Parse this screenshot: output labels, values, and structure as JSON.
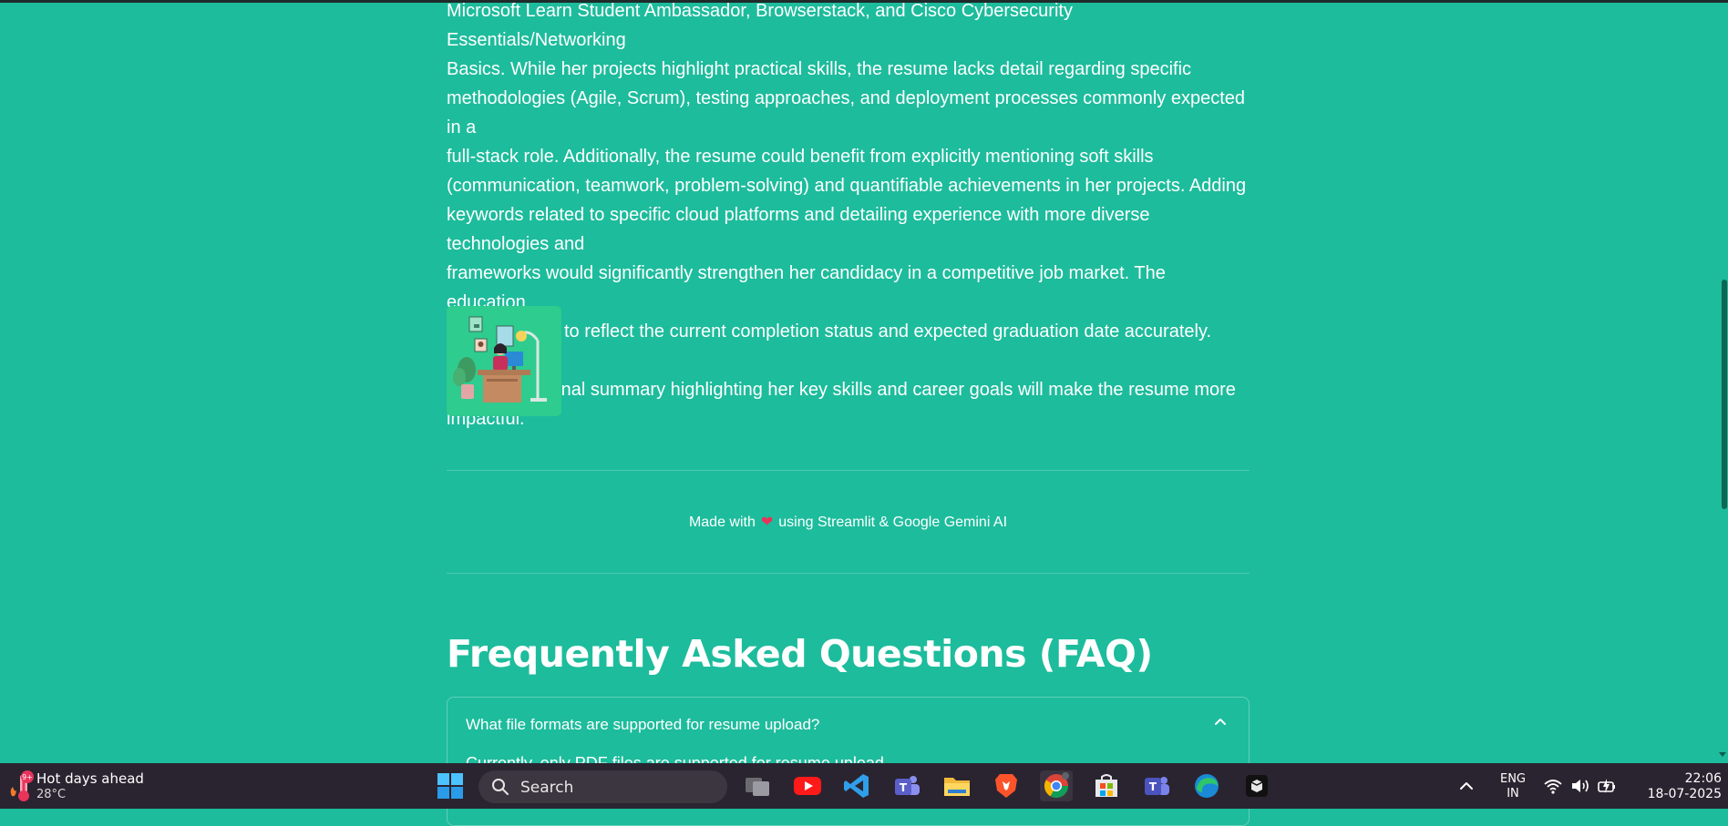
{
  "main": {
    "paragraph": "Microsoft Learn Student Ambassador, Browserstack, and Cisco Cybersecurity Essentials/Networking\nBasics. While her projects highlight practical skills, the resume lacks detail regarding specific\nmethodologies (Agile, Scrum), testing approaches, and deployment processes commonly expected in a\nfull-stack role. Additionally, the resume could benefit from explicitly mentioning soft skills\n(communication, teamwork, problem-solving) and quantifiable achievements in her projects. Adding\nkeywords related to specific cloud platforms and detailing experience with more diverse technologies and\nframeworks would significantly strengthen her candidacy in a competitive job market. The education\nsection needs to reflect the current completion status and expected graduation date accurately. Adding a\nbrief professional summary highlighting her key skills and career goals will make the resume more\nimpactful.",
    "footer": {
      "prefix": "Made with",
      "heart": "❤",
      "suffix": "using Streamlit & Google Gemini AI"
    },
    "faq": {
      "title": "Frequently Asked Questions (FAQ)",
      "items": [
        {
          "question": "What file formats are supported for resume upload?",
          "answer": "Currently, only PDF files are supported for resume upload."
        }
      ]
    }
  },
  "taskbar": {
    "weather": {
      "badge": "9+",
      "title": "Hot days ahead",
      "temp": "28°C"
    },
    "search_label": "Search",
    "apps": [
      "windows-start-icon",
      "task-view-icon",
      "youtube-icon",
      "vscode-icon",
      "teams-icon",
      "file-explorer-icon",
      "brave-icon",
      "chrome-icon",
      "microsoft-store-icon",
      "teams-classic-icon",
      "edge-icon",
      "app-box-icon"
    ],
    "lang_top": "ENG",
    "lang_bottom": "IN",
    "time": "22:06",
    "date": "18-07-2025"
  },
  "colors": {
    "page_bg": "#1DBC9C",
    "taskbar_bg": "#2a2430",
    "heart": "#e8335b"
  }
}
